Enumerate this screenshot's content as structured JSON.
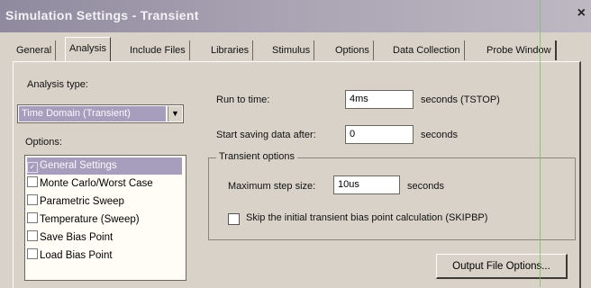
{
  "window": {
    "title": "Simulation Settings - Transient",
    "close_glyph": "×"
  },
  "tabs": [
    {
      "label": "General"
    },
    {
      "label": "Analysis"
    },
    {
      "label": "Include Files"
    },
    {
      "label": "Libraries"
    },
    {
      "label": "Stimulus"
    },
    {
      "label": "Options"
    },
    {
      "label": "Data Collection"
    },
    {
      "label": "Probe Window"
    }
  ],
  "analysis": {
    "type_label": "Analysis type:",
    "type_value": "Time Domain (Transient)",
    "options_label": "Options:",
    "options": [
      {
        "label": "General Settings"
      },
      {
        "label": "Monte Carlo/Worst Case"
      },
      {
        "label": "Parametric Sweep"
      },
      {
        "label": "Temperature (Sweep)"
      },
      {
        "label": "Save Bias Point"
      },
      {
        "label": "Load Bias Point"
      }
    ],
    "check_glyph": "✓"
  },
  "settings": {
    "run_to_label": "Run to time:",
    "run_to_value": "4ms",
    "run_to_unit": "seconds  (TSTOP)",
    "start_saving_label": "Start saving data after:",
    "start_saving_value": "0",
    "start_saving_unit": "seconds",
    "transient_group_title": "Transient options",
    "max_step_label": "Maximum step size:",
    "max_step_value": "10us",
    "max_step_unit": "seconds",
    "skip_bias_label": "Skip the initial transient bias point calculation  (SKIPBP)",
    "skip_bias_checked": false,
    "output_button": "Output File Options..."
  }
}
